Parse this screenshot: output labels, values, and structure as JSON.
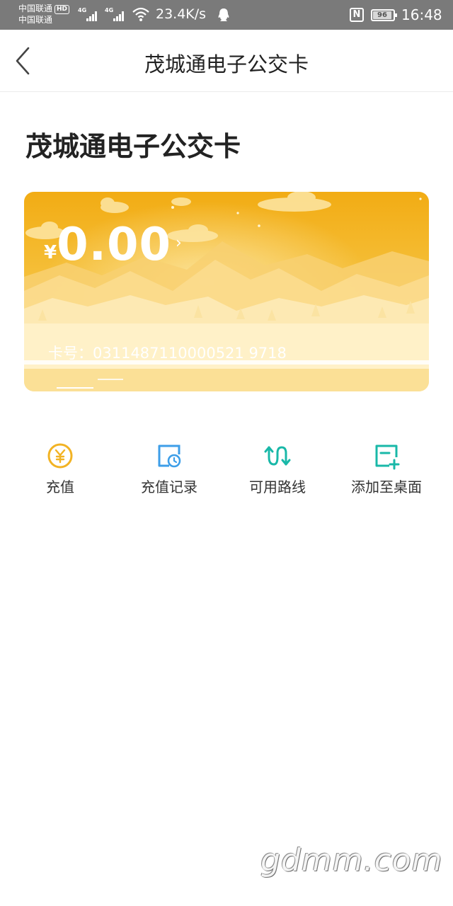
{
  "status_bar": {
    "carrier_1": "中国联通",
    "hd_badge": "HD",
    "carrier_2": "中国联通",
    "network_1": "4G",
    "network_2": "4G",
    "speed": "23.4K/s",
    "nfc": "N",
    "battery_level": "96",
    "time": "16:48"
  },
  "nav": {
    "title": "茂城通电子公交卡",
    "back_icon": "chevron-left-icon"
  },
  "page": {
    "title": "茂城通电子公交卡"
  },
  "card": {
    "currency": "¥",
    "balance": "0.00",
    "arrow": "›",
    "card_number": "卡号：0311487110000521 9718",
    "colors": {
      "primary": "#f3b52a",
      "light": "#fde6a8"
    }
  },
  "actions": [
    {
      "label": "充值",
      "icon": "yen-coin-icon",
      "color": "#f2b324"
    },
    {
      "label": "充值记录",
      "icon": "card-clock-icon",
      "color": "#3d9ee8"
    },
    {
      "label": "可用路线",
      "icon": "route-arrows-icon",
      "color": "#19b8a8"
    },
    {
      "label": "添加至桌面",
      "icon": "add-to-desktop-icon",
      "color": "#19b8a8"
    }
  ],
  "watermark": "gdmm.com"
}
